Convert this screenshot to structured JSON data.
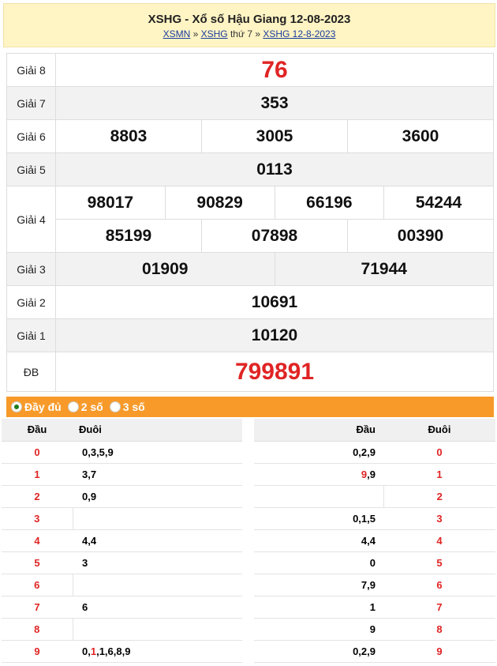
{
  "header": {
    "title": "XSHG - Xổ số Hậu Giang 12-08-2023",
    "crumb1": "XSMN",
    "sep1": " » ",
    "crumb2": "XSHG",
    "crumb2_suffix": " thứ 7 » ",
    "crumb3": "XSHG 12-8-2023"
  },
  "prizes": {
    "g8": {
      "label": "Giải 8",
      "values": [
        "76"
      ]
    },
    "g7": {
      "label": "Giải 7",
      "values": [
        "353"
      ]
    },
    "g6": {
      "label": "Giải 6",
      "values": [
        "8803",
        "3005",
        "3600"
      ]
    },
    "g5": {
      "label": "Giải 5",
      "values": [
        "0113"
      ]
    },
    "g4": {
      "label": "Giải 4",
      "values": [
        "98017",
        "90829",
        "66196",
        "54244",
        "85199",
        "07898",
        "00390"
      ]
    },
    "g3": {
      "label": "Giải 3",
      "values": [
        "01909",
        "71944"
      ]
    },
    "g2": {
      "label": "Giải 2",
      "values": [
        "10691"
      ]
    },
    "g1": {
      "label": "Giải 1",
      "values": [
        "10120"
      ]
    },
    "db": {
      "label": "ĐB",
      "values": [
        "799891"
      ]
    }
  },
  "options": [
    {
      "label": "Đầy đủ",
      "selected": true
    },
    {
      "label": "2 số",
      "selected": false
    },
    {
      "label": "3 số",
      "selected": false
    }
  ],
  "loto_left": {
    "head_label": "Đầu",
    "tail_label": "Đuôi",
    "rows": [
      {
        "head": "0",
        "tail": "0,3,5,9"
      },
      {
        "head": "1",
        "tail": "3,7"
      },
      {
        "head": "2",
        "tail": "0,9"
      },
      {
        "head": "3",
        "tail": ""
      },
      {
        "head": "4",
        "tail": "4,4"
      },
      {
        "head": "5",
        "tail": "3"
      },
      {
        "head": "6",
        "tail": ""
      },
      {
        "head": "7",
        "tail": "6"
      },
      {
        "head": "8",
        "tail": ""
      },
      {
        "head": "9",
        "tail_pre": "0,",
        "tail_red": "1",
        "tail_post": ",1,6,8,9"
      }
    ]
  },
  "loto_right": {
    "head_label": "Đầu",
    "tail_label": "Đuôi",
    "rows": [
      {
        "head": "0,2,9",
        "tail": "0"
      },
      {
        "head_red": "9",
        "head_post": ",9",
        "tail": "1"
      },
      {
        "head": "",
        "tail": "2"
      },
      {
        "head": "0,1,5",
        "tail": "3"
      },
      {
        "head": "4,4",
        "tail": "4"
      },
      {
        "head": "0",
        "tail": "5"
      },
      {
        "head": "7,9",
        "tail": "6"
      },
      {
        "head": "1",
        "tail": "7"
      },
      {
        "head": "9",
        "tail": "8"
      },
      {
        "head": "0,2,9",
        "tail": "9"
      }
    ]
  },
  "colors": {
    "accent_red": "#e02424",
    "orange_bar": "#f79a2a",
    "header_bg": "#fff4c4"
  }
}
